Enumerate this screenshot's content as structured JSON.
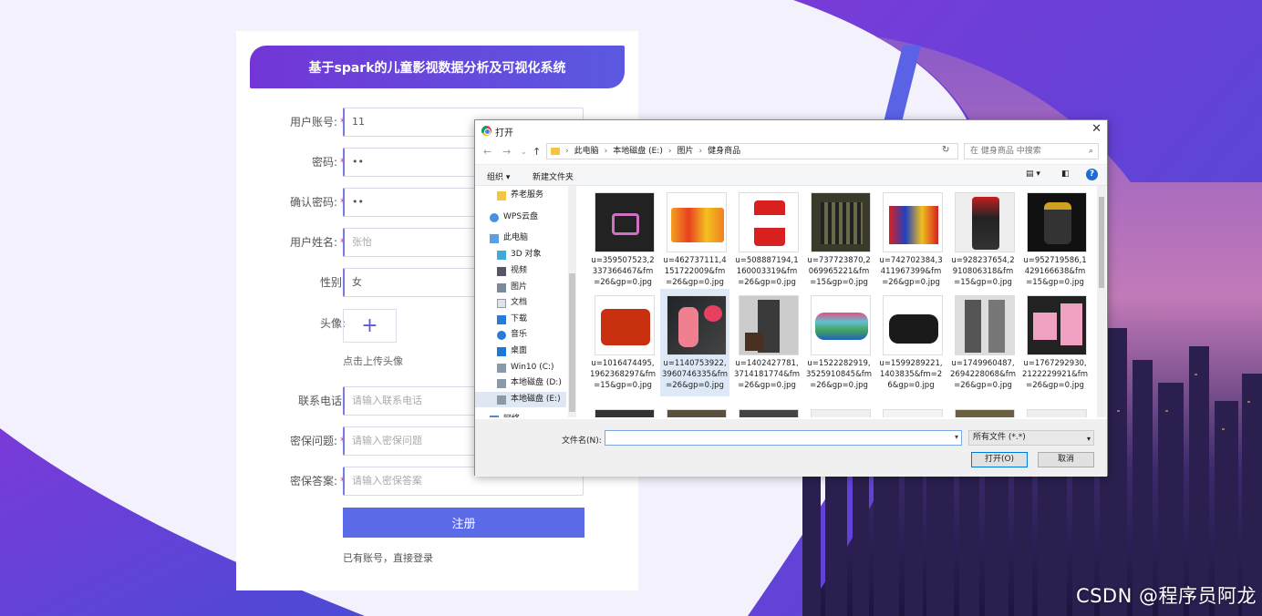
{
  "register_form": {
    "title": "基于spark的儿童影视数据分析及可视化系统",
    "fields": [
      {
        "label": "用户账号:",
        "required": true,
        "value": "11",
        "placeholder": ""
      },
      {
        "label": "密码:",
        "required": true,
        "value": "••",
        "placeholder": ""
      },
      {
        "label": "确认密码:",
        "required": true,
        "value": "••",
        "placeholder": ""
      },
      {
        "label": "用户姓名:",
        "required": true,
        "value": "",
        "placeholder": "张怡"
      },
      {
        "label": "性别:",
        "required": false,
        "value": "女",
        "placeholder": ""
      }
    ],
    "avatar_label": "头像:",
    "avatar_upload_symbol": "+",
    "avatar_tip": "点击上传头像",
    "fields2": [
      {
        "label": "联系电话:",
        "required": false,
        "placeholder": "请输入联系电话"
      },
      {
        "label": "密保问题:",
        "required": true,
        "placeholder": "请输入密保问题"
      },
      {
        "label": "密保答案:",
        "required": true,
        "placeholder": "请输入密保答案"
      }
    ],
    "required_mark": "*",
    "submit_label": "注册",
    "login_link": "已有账号，直接登录",
    "accent_color": "#5b6ae6"
  },
  "file_dialog": {
    "title": "打开",
    "close_symbol": "✕",
    "breadcrumb": [
      "此电脑",
      "本地磁盘 (E:)",
      "图片",
      "健身商品"
    ],
    "search_placeholder": "在 健身商品 中搜索",
    "toolbar": {
      "organize": "组织 ▾",
      "new_folder": "新建文件夹",
      "help": "?"
    },
    "sidebar": [
      {
        "label": "养老服务",
        "icon": "folder-icon"
      },
      {
        "label": "WPS云盘",
        "icon": "cloud-icon"
      },
      {
        "label": "此电脑",
        "icon": "computer-icon"
      },
      {
        "label": "3D 对象",
        "icon": "cube-icon"
      },
      {
        "label": "视频",
        "icon": "video-icon"
      },
      {
        "label": "图片",
        "icon": "picture-icon"
      },
      {
        "label": "文档",
        "icon": "document-icon"
      },
      {
        "label": "下载",
        "icon": "download-icon"
      },
      {
        "label": "音乐",
        "icon": "music-icon"
      },
      {
        "label": "桌面",
        "icon": "desktop-icon"
      },
      {
        "label": "Win10 (C:)",
        "icon": "drive-icon"
      },
      {
        "label": "本地磁盘 (D:)",
        "icon": "drive-icon"
      },
      {
        "label": "本地磁盘 (E:)",
        "icon": "drive-icon"
      },
      {
        "label": "网络",
        "icon": "network-icon"
      }
    ],
    "files": [
      "u=359507523,2337366467&fm=26&gp=0.jpg",
      "u=462737111,4151722009&fm=26&gp=0.jpg",
      "u=508887194,1160003319&fm=26&gp=0.jpg",
      "u=737723870,2069965221&fm=15&gp=0.jpg",
      "u=742702384,3411967399&fm=26&gp=0.jpg",
      "u=928237654,2910806318&fm=15&gp=0.jpg",
      "u=952719586,1429166638&fm=15&gp=0.jpg",
      "u=1016474495,1962368297&fm=15&gp=0.jpg",
      "u=1140753922,3960746335&fm=26&gp=0.jpg",
      "u=1402427781,3714181774&fm=26&gp=0.jpg",
      "u=1522282919,3525910845&fm=26&gp=0.jpg",
      "u=1599289221,1403835&fm=26&gp=0.jpg",
      "u=1749960487,2694228068&fm=26&gp=0.jpg",
      "u=1767292930,2122229921&fm=26&gp=0.jpg"
    ],
    "filename_label": "文件名(N):",
    "filename_value": "",
    "filetype": "所有文件 (*.*)",
    "open_label": "打开(O)",
    "cancel_label": "取消"
  },
  "watermark": "CSDN @程序员阿龙"
}
